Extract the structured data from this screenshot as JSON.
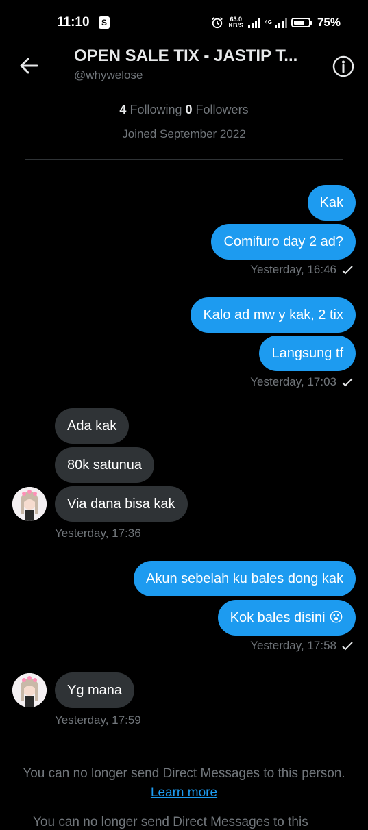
{
  "status_bar": {
    "time": "11:10",
    "speed_top": "63.0",
    "speed_bottom": "KB/S",
    "network": "4G",
    "battery_percent": "75%",
    "battery_level": 0.75
  },
  "header": {
    "title": "OPEN SALE TIX - JASTIP T...",
    "handle": "@whywelose",
    "back_icon": "arrow-left-icon",
    "info_icon": "info-icon"
  },
  "profile": {
    "following_count": "4",
    "following_label": "Following",
    "followers_count": "0",
    "followers_label": "Followers",
    "joined": "Joined September 2022"
  },
  "messages": [
    {
      "dir": "out",
      "text": "Kak"
    },
    {
      "dir": "out",
      "text": "Comifuro day 2 ad?"
    },
    {
      "dir": "out_ts",
      "text": "Yesterday, 16:46"
    },
    {
      "dir": "out",
      "text": "Kalo ad mw y kak, 2 tix"
    },
    {
      "dir": "out",
      "text": "Langsung tf"
    },
    {
      "dir": "out_ts",
      "text": "Yesterday, 17:03"
    },
    {
      "dir": "in",
      "text": "Ada kak"
    },
    {
      "dir": "in",
      "text": "80k satunua"
    },
    {
      "dir": "in",
      "text": "Via dana bisa kak"
    },
    {
      "dir": "in_ts",
      "text": "Yesterday, 17:36"
    },
    {
      "dir": "out",
      "text": "Akun sebelah ku bales dong kak"
    },
    {
      "dir": "out",
      "text": "Kok bales disini 😮"
    },
    {
      "dir": "out_ts",
      "text": "Yesterday, 17:58"
    },
    {
      "dir": "in",
      "text": "Yg mana"
    },
    {
      "dir": "in_ts",
      "text": "Yesterday, 17:59"
    }
  ],
  "footer": {
    "notice": "You can no longer send Direct Messages to this person.",
    "link": "Learn more",
    "cut_text": "You can no longer send Direct Messages to this"
  },
  "colors": {
    "accent": "#1d9bf0",
    "incoming_bubble": "#2f3336",
    "background": "#000000",
    "muted_text": "#71767b"
  }
}
